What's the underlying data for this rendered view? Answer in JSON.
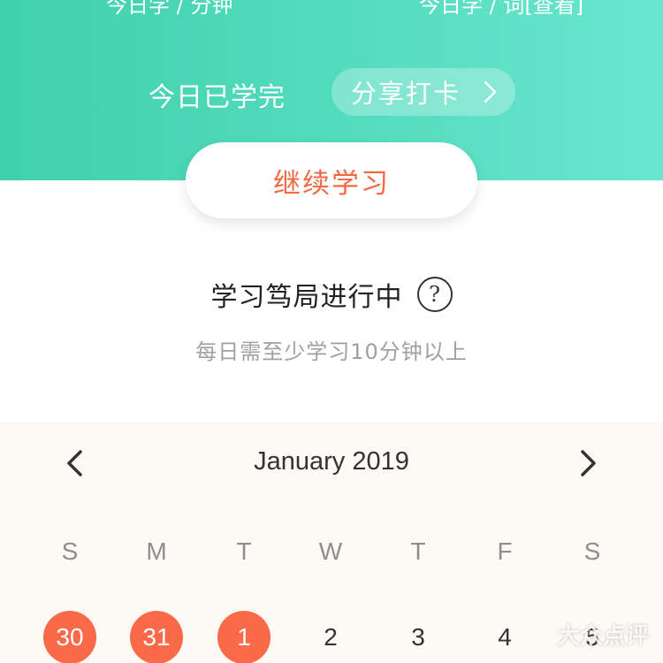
{
  "header": {
    "stat_left_cut": "今日学 / 分钟",
    "stat_right_cut": "今日学 / 词[查看]",
    "done_label": "今日已学完",
    "share_label": "分享打卡",
    "share_icon": "chevron-right-icon",
    "continue_label": "继续学习"
  },
  "status": {
    "title": "学习笃局进行中",
    "help_glyph": "?",
    "hint": "每日需至少学习10分钟以上"
  },
  "calendar": {
    "month": "January 2019",
    "weekdays": [
      "S",
      "M",
      "T",
      "W",
      "T",
      "F",
      "S"
    ],
    "days": [
      "30",
      "31",
      "1",
      "2",
      "3",
      "4",
      "5"
    ],
    "completed_days": [
      "30",
      "31",
      "1"
    ],
    "completed_color": "#fa6a48"
  },
  "watermark": "大众点评",
  "colors": {
    "header_gradient_start": "#3fd0ac",
    "header_gradient_end": "#6ae6cf",
    "accent_orange": "#f26a45"
  }
}
